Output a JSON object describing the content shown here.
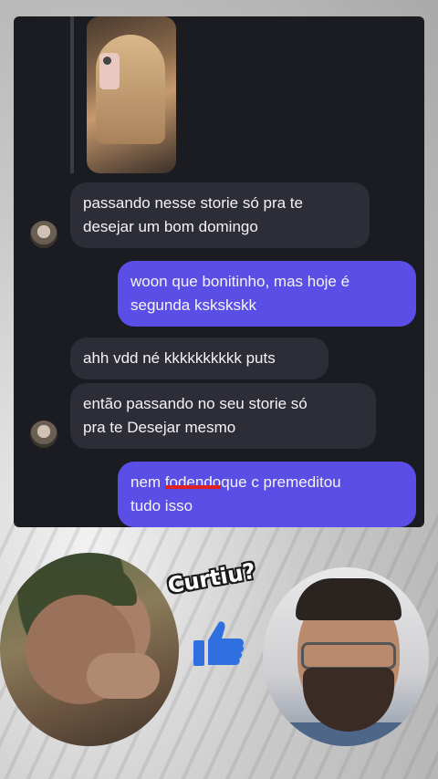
{
  "messages": [
    {
      "direction": "in",
      "text_1": "passando nesse storie só pra te",
      "text_2": "desejar um bom domingo"
    },
    {
      "direction": "out",
      "text_1": "woon que bonitinho, mas hoje é",
      "text_2": "segunda kskskskk"
    },
    {
      "direction": "in",
      "text_1": "ahh vdd né kkkkkkkkkk puts"
    },
    {
      "direction": "in",
      "text_1": "então passando no seu storie só",
      "text_2": "pra te Desejar mesmo"
    },
    {
      "direction": "out",
      "text_prefix": "nem ",
      "text_struck": "fodendo",
      "text_suffix": "que c premeditou",
      "text_2": "tudo isso"
    }
  ],
  "overlay": {
    "caption": "Curtiu?"
  },
  "colors": {
    "chat_background": "#1b1c22",
    "incoming_bubble": "#2c2d36",
    "outgoing_bubble": "#5b4ee6",
    "thumbs_up": "#2f6fe0"
  },
  "icons": {
    "thumbs_up": "thumbs-up-icon"
  }
}
